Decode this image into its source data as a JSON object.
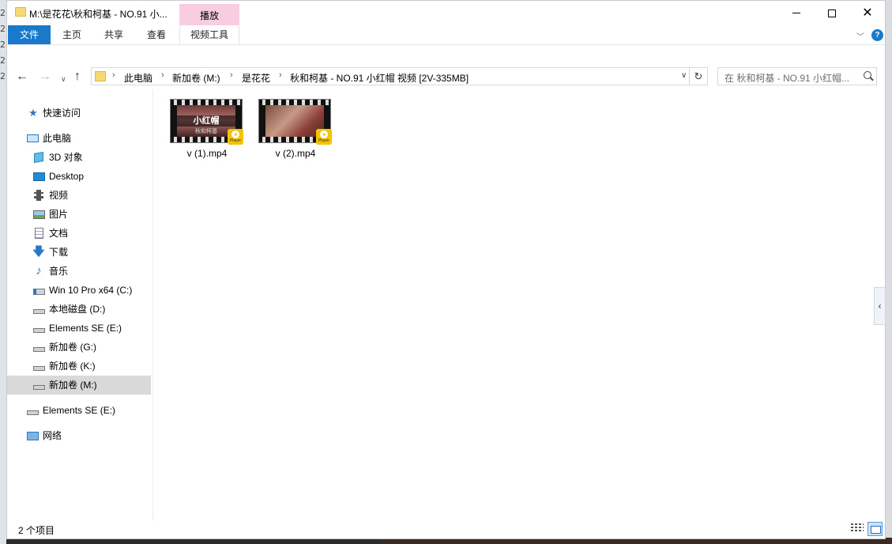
{
  "background": {
    "left_digits": [
      "2",
      "2",
      "2",
      "2",
      "2"
    ]
  },
  "window": {
    "title": "M:\\是花花\\秋和柯基 - NO.91 小...",
    "context_tab_group": "播放",
    "controls": {
      "minimize": "—",
      "maximize": "□",
      "close": "✕"
    }
  },
  "ribbon": {
    "tabs": [
      "文件",
      "主页",
      "共享",
      "查看",
      "视频工具"
    ],
    "active_tab": "文件",
    "accent_color": "#1979ca",
    "context_color": "#f8cde0",
    "help_icon": "?"
  },
  "address": {
    "breadcrumbs": [
      "此电脑",
      "新加卷 (M:)",
      "是花花",
      "秋和柯基 - NO.91 小红帽 视频 [2V-335MB]"
    ],
    "search_placeholder": "在 秋和柯基 - NO.91 小红帽..."
  },
  "sidebar": {
    "items": [
      {
        "label": "快速访问",
        "icon": "star-icon"
      },
      {
        "label": "此电脑",
        "icon": "pc-icon"
      },
      {
        "label": "3D 对象",
        "icon": "cube-icon"
      },
      {
        "label": "Desktop",
        "icon": "desktop-icon"
      },
      {
        "label": "视频",
        "icon": "video-icon"
      },
      {
        "label": "图片",
        "icon": "picture-icon"
      },
      {
        "label": "文档",
        "icon": "document-icon"
      },
      {
        "label": "下载",
        "icon": "download-icon"
      },
      {
        "label": "音乐",
        "icon": "music-icon"
      },
      {
        "label": "Win 10 Pro x64 (C:)",
        "icon": "system-drive-icon"
      },
      {
        "label": "本地磁盘 (D:)",
        "icon": "drive-icon"
      },
      {
        "label": "Elements SE (E:)",
        "icon": "drive-icon"
      },
      {
        "label": "新加卷 (G:)",
        "icon": "drive-icon"
      },
      {
        "label": "新加卷 (K:)",
        "icon": "drive-icon"
      },
      {
        "label": "新加卷 (M:)",
        "icon": "drive-icon",
        "selected": true
      },
      {
        "label": "Elements SE (E:)",
        "icon": "drive-icon"
      },
      {
        "label": "网络",
        "icon": "network-icon"
      }
    ]
  },
  "files": [
    {
      "name": "v (1).mp4",
      "thumb_caption": "小红帽",
      "thumb_subcaption": "秋和柯基",
      "badge": "Player"
    },
    {
      "name": "v (2).mp4",
      "thumb_caption": "",
      "thumb_subcaption": "",
      "badge": "Player"
    }
  ],
  "status": {
    "item_count": "2 个项目"
  }
}
